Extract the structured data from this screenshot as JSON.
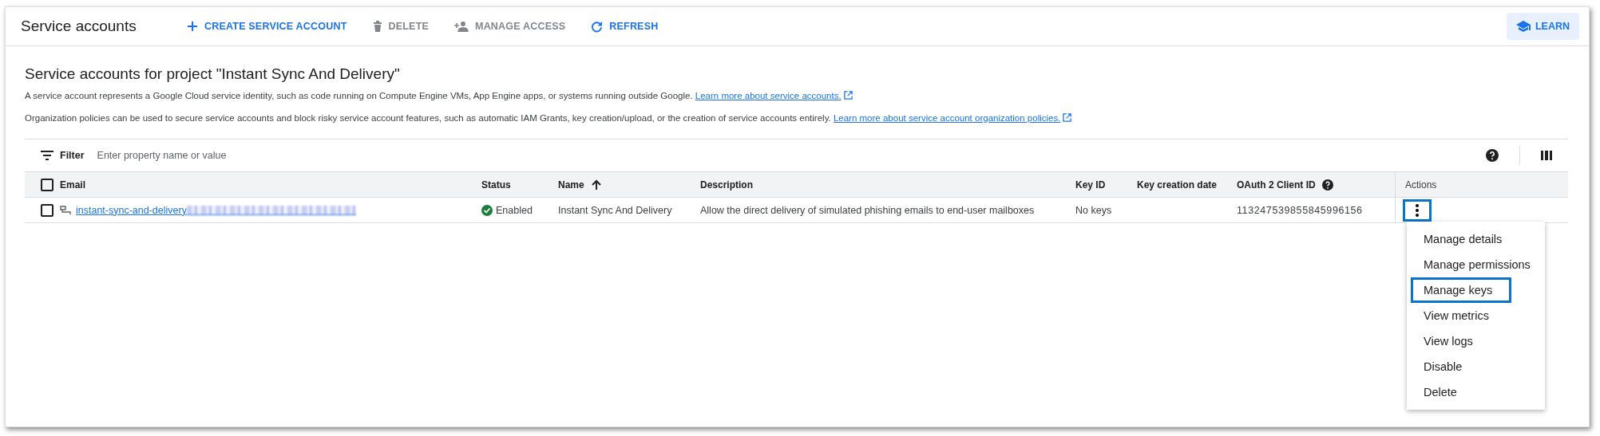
{
  "header": {
    "title": "Service accounts",
    "actions": [
      {
        "kind": "add",
        "label": "CREATE SERVICE ACCOUNT",
        "disabled": false
      },
      {
        "kind": "delete",
        "label": "DELETE",
        "disabled": true
      },
      {
        "kind": "access",
        "label": "MANAGE ACCESS",
        "disabled": true
      },
      {
        "kind": "refresh",
        "label": "REFRESH",
        "disabled": false
      }
    ],
    "learn": "LEARN"
  },
  "heading": "Service accounts for project \"Instant Sync And Delivery\"",
  "paragraphs": [
    {
      "text": "A service account represents a Google Cloud service identity, such as code running on Compute Engine VMs, App Engine apps, or systems running outside Google.",
      "link": "Learn more about service accounts."
    },
    {
      "text": "Organization policies can be used to secure service accounts and block risky service account features, such as automatic IAM Grants, key creation/upload, or the creation of service accounts entirely.",
      "link": "Learn more about service account organization policies."
    }
  ],
  "filter": {
    "label": "Filter",
    "placeholder": "Enter property name or value"
  },
  "table": {
    "select_all_checked": false,
    "columns": [
      "Email",
      "Status",
      "Name",
      "Description",
      "Key ID",
      "Key creation date",
      "OAuth 2 Client ID",
      "Actions"
    ],
    "rows": [
      {
        "checked": false,
        "email": "instant-sync-and-delivery",
        "status": "Enabled",
        "name": "Instant Sync And Delivery",
        "description": "Allow the direct delivery of simulated phishing emails to end-user mailboxes",
        "key_id": "No keys",
        "client_id": "113247539855845996156"
      }
    ]
  },
  "menu": [
    {
      "label": "Manage details",
      "selected": false
    },
    {
      "label": "Manage permissions",
      "selected": false
    },
    {
      "label": "Manage keys",
      "selected": true
    },
    {
      "label": "View metrics",
      "selected": false
    },
    {
      "label": "View logs",
      "selected": false
    },
    {
      "label": "Disable",
      "selected": false
    },
    {
      "label": "Delete",
      "selected": false
    }
  ]
}
